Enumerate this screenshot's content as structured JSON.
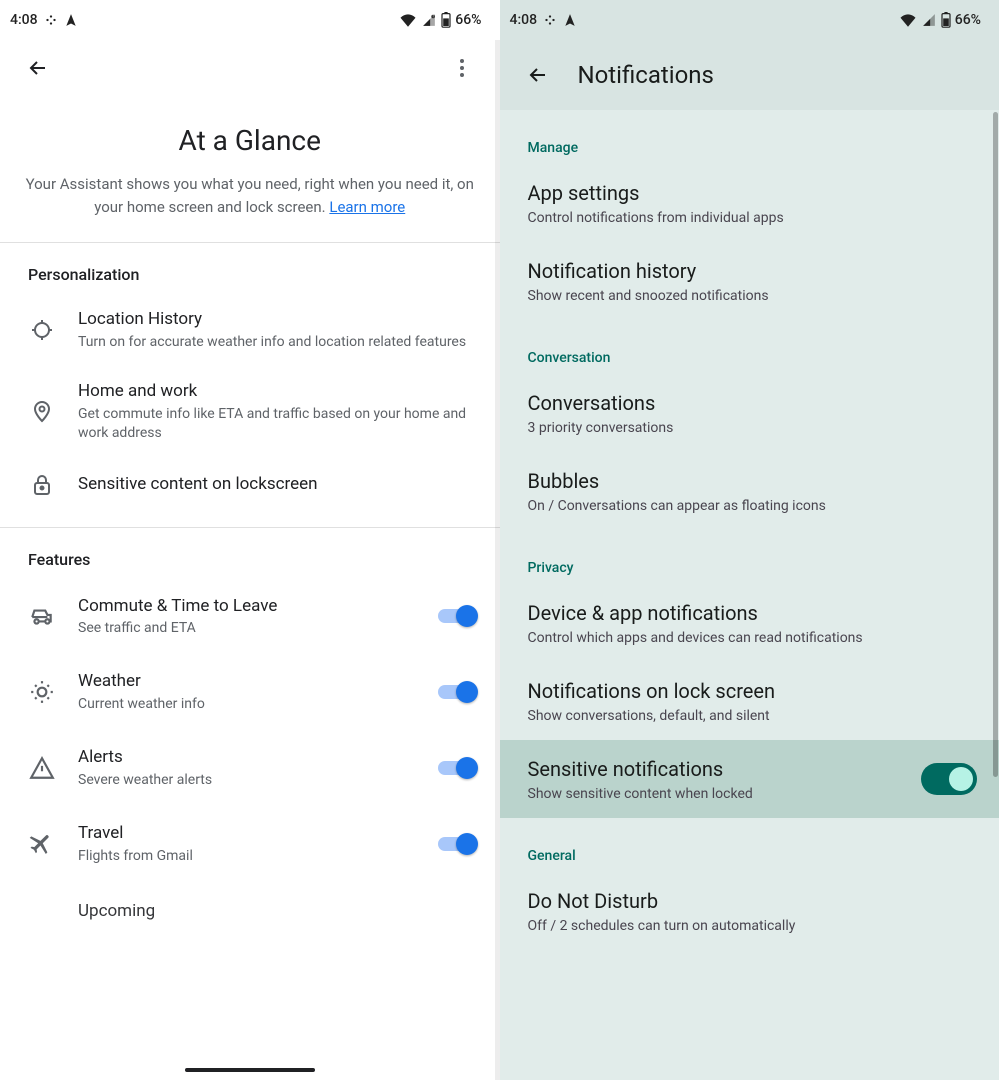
{
  "status": {
    "time": "4:08",
    "battery": "66%"
  },
  "left": {
    "page_title": "At a Glance",
    "subtitle_pre": "Your Assistant shows you what you need, right when you need it, on your home screen and lock screen. ",
    "learn_more": "Learn more",
    "section_personalization": "Personalization",
    "personalization": [
      {
        "title": "Location History",
        "desc": "Turn on for accurate weather info and location related features",
        "icon": "location-crosshair-icon"
      },
      {
        "title": "Home and work",
        "desc": "Get commute info like ETA and traffic based on your home and work address",
        "icon": "pin-icon"
      },
      {
        "title": "Sensitive content on lockscreen",
        "desc": "",
        "icon": "lock-icon"
      }
    ],
    "section_features": "Features",
    "features": [
      {
        "title": "Commute & Time to Leave",
        "desc": "See traffic and ETA",
        "icon": "car-icon"
      },
      {
        "title": "Weather",
        "desc": "Current weather info",
        "icon": "sun-icon"
      },
      {
        "title": "Alerts",
        "desc": "Severe weather alerts",
        "icon": "alert-triangle-icon"
      },
      {
        "title": "Travel",
        "desc": "Flights from Gmail",
        "icon": "airplane-icon"
      },
      {
        "title": "Upcoming",
        "desc": "",
        "icon": "calendar-icon"
      }
    ]
  },
  "right": {
    "page_title": "Notifications",
    "cat_manage": "Manage",
    "manage": [
      {
        "title": "App settings",
        "desc": "Control notifications from individual apps"
      },
      {
        "title": "Notification history",
        "desc": "Show recent and snoozed notifications"
      }
    ],
    "cat_conversation": "Conversation",
    "conversation": [
      {
        "title": "Conversations",
        "desc": "3 priority conversations"
      },
      {
        "title": "Bubbles",
        "desc": "On / Conversations can appear as floating icons"
      }
    ],
    "cat_privacy": "Privacy",
    "privacy": [
      {
        "title": "Device & app notifications",
        "desc": "Control which apps and devices can read notifications"
      },
      {
        "title": "Notifications on lock screen",
        "desc": "Show conversations, default, and silent"
      }
    ],
    "sensitive": {
      "title": "Sensitive notifications",
      "desc": "Show sensitive content when locked"
    },
    "cat_general": "General",
    "general": [
      {
        "title": "Do Not Disturb",
        "desc": "Off / 2 schedules can turn on automatically"
      }
    ]
  }
}
